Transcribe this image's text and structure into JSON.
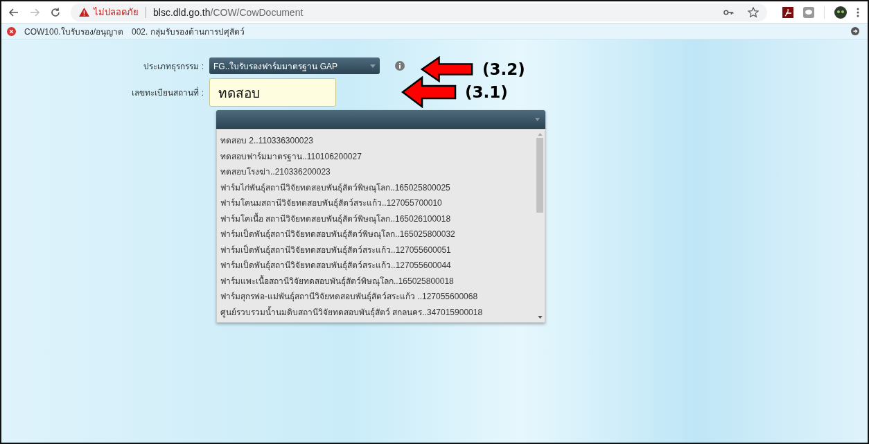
{
  "browser": {
    "security_label": "ไม่ปลอดภัย",
    "url_host": "blsc.dld.go.th",
    "url_path": "/COW/CowDocument"
  },
  "breadcrumb": [
    "COW100.ใบรับรอง/อนุญาต",
    "002. กลุ่มรับรองด้านการปศุสัตว์"
  ],
  "form": {
    "business_type": {
      "label": "ประเภทธุรกรรม :",
      "value": "FG..ใบรับรองฟาร์มมาตรฐาน GAP"
    },
    "registration": {
      "label": "เลขทะเบียนสถานที่ :",
      "value": "ทดสอบ"
    }
  },
  "dropdown": {
    "options": [
      "ทดสอบ 2..110336300023",
      "ทดสอบฟาร์มมาตรฐาน..110106200027",
      "ทดสอบโรงฆ่า..210336200023",
      "ฟาร์มไก่พันธุ์สถานีวิจัยทดสอบพันธุ์สัตว์พิษณุโลก..165025800025",
      "ฟาร์มโคนมสถานีวิจัยทดสอบพันธุ์สัตว์สระแก้ว..127055700010",
      "ฟาร์มโคเนื้อ สถานีวิจัยทดสอบพันธุ์สัตว์พิษณุโลก..165026100018",
      "ฟาร์มเป็ดพันธุ์สถานีวิจัยทดสอบพันธุ์สัตว์พิษณุโลก..165025800032",
      "ฟาร์มเป็ดพันธุ์สถานีวิจัยทดสอบพันธุ์สัตว์สระแก้ว..127055600051",
      "ฟาร์มเป็ดพันธุ์สถานีวิจัยทดสอบพันธุ์สัตว์สระแก้ว..127055600044",
      "ฟาร์มแพะเนื้อสถานีวิจัยทดสอบพันธุ์สัตว์พิษณุโลก..165025800018",
      "ฟาร์มสุกรพ่อ-แม่พันธุ์สถานีวิจัยทดสอบพันธุ์สัตว์สระแก้ว ..127055600068",
      "ศูนย์รวบรวมน้ำนมดิบสถานีวิจัยทดสอบพันธุ์สัตว์ สกลนคร..347015900018"
    ]
  },
  "annotations": [
    "(3.2)",
    "(3.1)"
  ]
}
